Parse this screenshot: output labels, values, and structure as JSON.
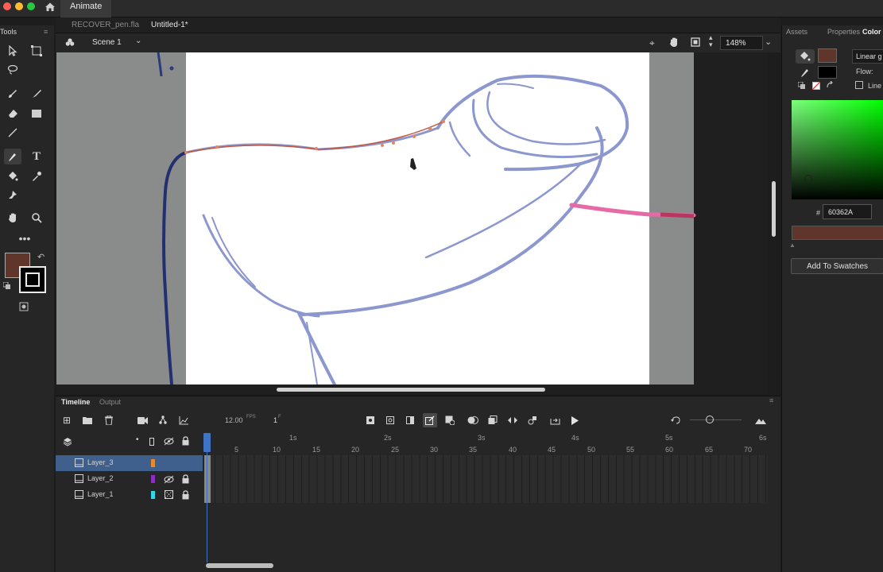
{
  "app": {
    "name": "Animate"
  },
  "tools_panel": {
    "title": "Tools"
  },
  "doc_tabs": [
    {
      "label": "RECOVER_pen.fla"
    },
    {
      "label": "Untitled-1*"
    }
  ],
  "edit_bar": {
    "scene": "Scene 1",
    "zoom": "148%"
  },
  "right_panel": {
    "tabs": [
      "Assets",
      "Properties",
      "Color"
    ],
    "fill_type": "Linear g",
    "flow_label": "Flow:",
    "line_label": "Line",
    "hex_symbol": "#",
    "hex_value": "60362A",
    "add_swatch_label": "Add To Swatches",
    "colors": {
      "fill": "#60362A",
      "stroke": "#000000"
    }
  },
  "timeline": {
    "tabs": [
      "Timeline",
      "Output"
    ],
    "fps_value": "12.00",
    "fps_unit": "FPS",
    "frame_value": "1",
    "frame_unit": "F",
    "seconds": [
      "1s",
      "2s",
      "3s",
      "4s",
      "5s",
      "6s"
    ],
    "frame_numbers": [
      "5",
      "10",
      "15",
      "20",
      "25",
      "30",
      "35",
      "40",
      "45",
      "50",
      "55",
      "60",
      "65",
      "70"
    ],
    "layers": [
      {
        "name": "Layer_3",
        "color": "#e58a2e",
        "selected": true
      },
      {
        "name": "Layer_2",
        "color": "#8b2ec2",
        "selected": false
      },
      {
        "name": "Layer_1",
        "color": "#33d8e8",
        "selected": false
      }
    ]
  }
}
